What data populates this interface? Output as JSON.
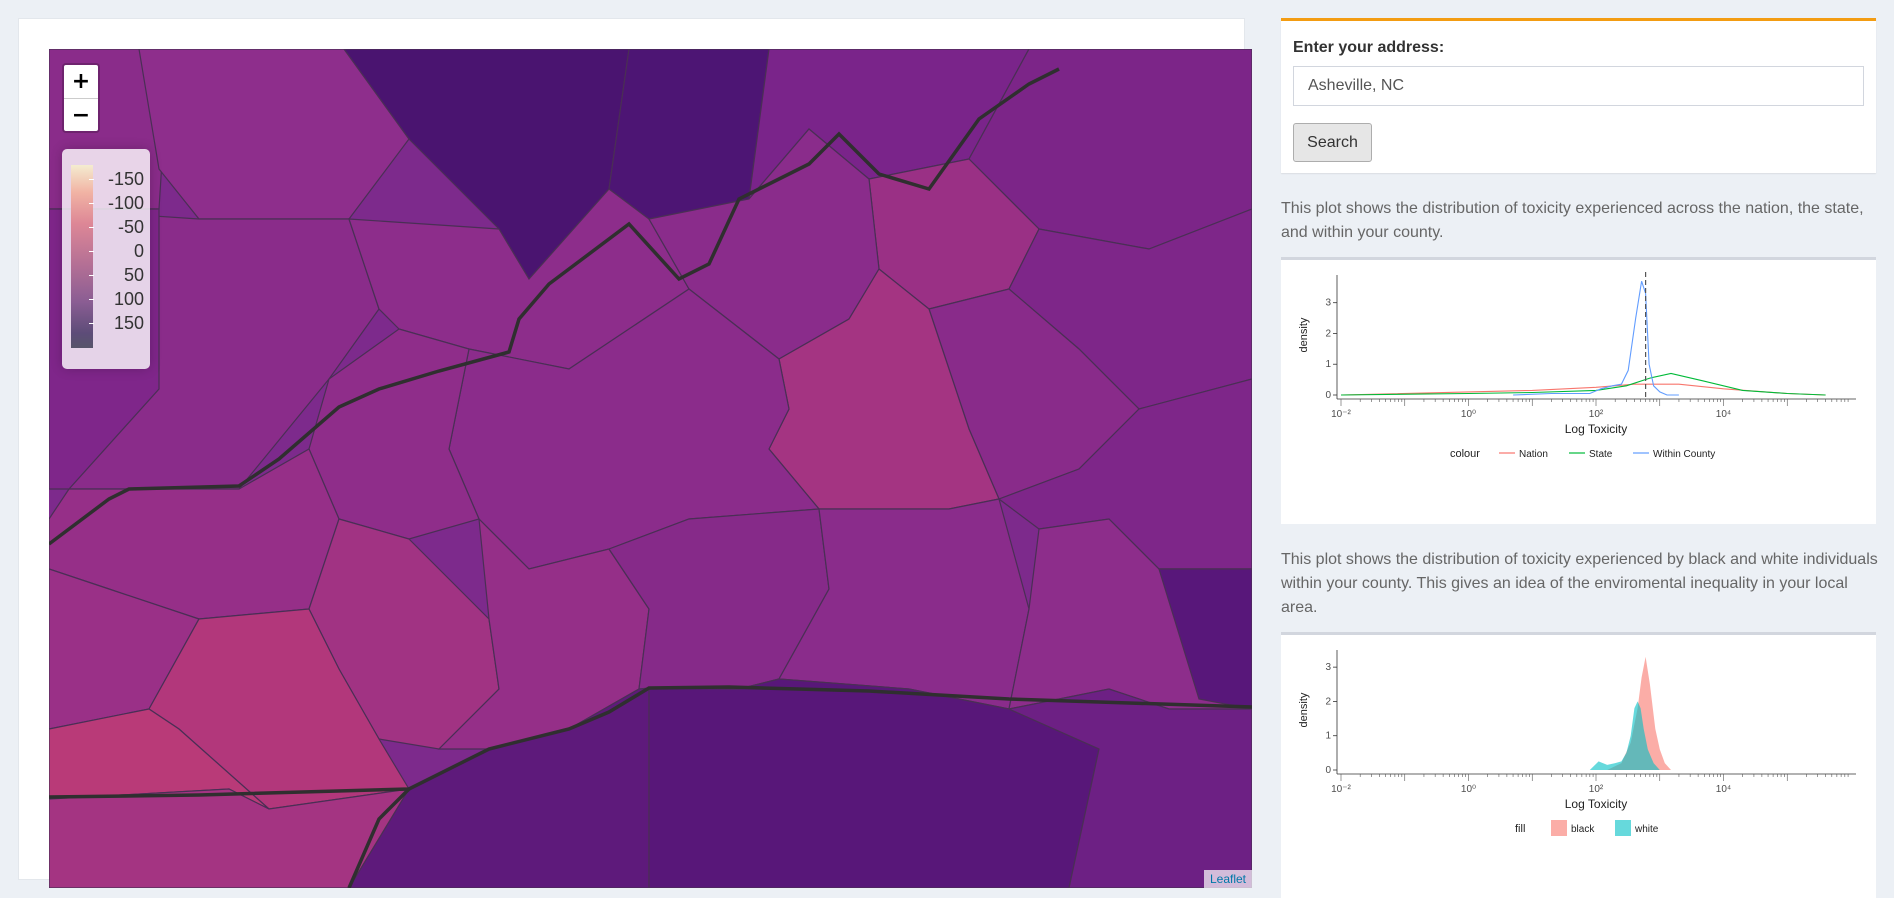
{
  "map": {
    "zoom_in_label": "+",
    "zoom_out_label": "−",
    "legend": {
      "labels": [
        "-150",
        "-100",
        "-50",
        "0",
        "50",
        "100",
        "150"
      ]
    },
    "attribution": "Leaflet"
  },
  "address": {
    "label": "Enter your address:",
    "value": "Asheville, NC",
    "search_label": "Search"
  },
  "plot1_description": "This plot shows the distribution of toxicity experienced across the nation, the state, and within your county.",
  "plot2_description": "This plot shows the distribution of toxicity experienced by black and white individuals within your county. This gives an idea of the enviromental inequality in your local area.",
  "chart_data": [
    {
      "type": "line",
      "xlabel": "Log Toxicity",
      "ylabel": "density",
      "x_scale": "log10",
      "xlim": [
        0.01,
        1000000
      ],
      "ylim": [
        0,
        3.9
      ],
      "x_tick_labels": [
        "10⁻²",
        "10⁰",
        "10²",
        "10⁴"
      ],
      "y_tick_labels": [
        "0",
        "1",
        "2",
        "3"
      ],
      "vline_x": 600,
      "legend": {
        "title": "colour",
        "placement": "bottom"
      },
      "series": [
        {
          "name": "Nation",
          "color": "#f8766d",
          "x": [
            0.01,
            1,
            10,
            100,
            400,
            2000,
            10000,
            100000,
            400000
          ],
          "y": [
            0.0,
            0.1,
            0.15,
            0.25,
            0.35,
            0.35,
            0.2,
            0.05,
            0.0
          ]
        },
        {
          "name": "State",
          "color": "#00ba38",
          "x": [
            0.01,
            1,
            10,
            100,
            300,
            700,
            1500,
            5000,
            20000,
            100000,
            400000
          ],
          "y": [
            0.0,
            0.05,
            0.08,
            0.15,
            0.3,
            0.55,
            0.7,
            0.45,
            0.15,
            0.05,
            0.0
          ]
        },
        {
          "name": "Within County",
          "color": "#619cff",
          "x": [
            5,
            20,
            50,
            80,
            120,
            180,
            250,
            320,
            420,
            520,
            600,
            680,
            800,
            1000,
            1300,
            2000
          ],
          "y": [
            0.0,
            0.05,
            0.05,
            0.05,
            0.2,
            0.3,
            0.35,
            0.8,
            2.5,
            3.7,
            3.3,
            1.0,
            0.3,
            0.1,
            0.0,
            0.0
          ]
        }
      ]
    },
    {
      "type": "area",
      "xlabel": "Log Toxicity",
      "ylabel": "density",
      "x_scale": "log10",
      "xlim": [
        0.01,
        1000000
      ],
      "ylim": [
        0,
        3.5
      ],
      "x_tick_labels": [
        "10⁻²",
        "10⁰",
        "10²",
        "10⁴"
      ],
      "y_tick_labels": [
        "0",
        "1",
        "2",
        "3"
      ],
      "legend": {
        "title": "fill",
        "placement": "bottom"
      },
      "series": [
        {
          "name": "black",
          "color": "#f8766d",
          "x": [
            150,
            250,
            350,
            450,
            520,
            600,
            700,
            850,
            1000,
            1200,
            1500
          ],
          "y": [
            0.0,
            0.2,
            0.8,
            1.8,
            2.7,
            3.3,
            2.5,
            1.2,
            0.6,
            0.2,
            0.0
          ]
        },
        {
          "name": "white",
          "color": "#00bfc4",
          "x": [
            80,
            110,
            150,
            200,
            250,
            300,
            350,
            400,
            450,
            500,
            560,
            650,
            800,
            1000
          ],
          "y": [
            0.0,
            0.25,
            0.15,
            0.2,
            0.25,
            0.5,
            1.0,
            1.8,
            2.0,
            1.8,
            1.2,
            0.6,
            0.2,
            0.0
          ]
        }
      ]
    }
  ]
}
